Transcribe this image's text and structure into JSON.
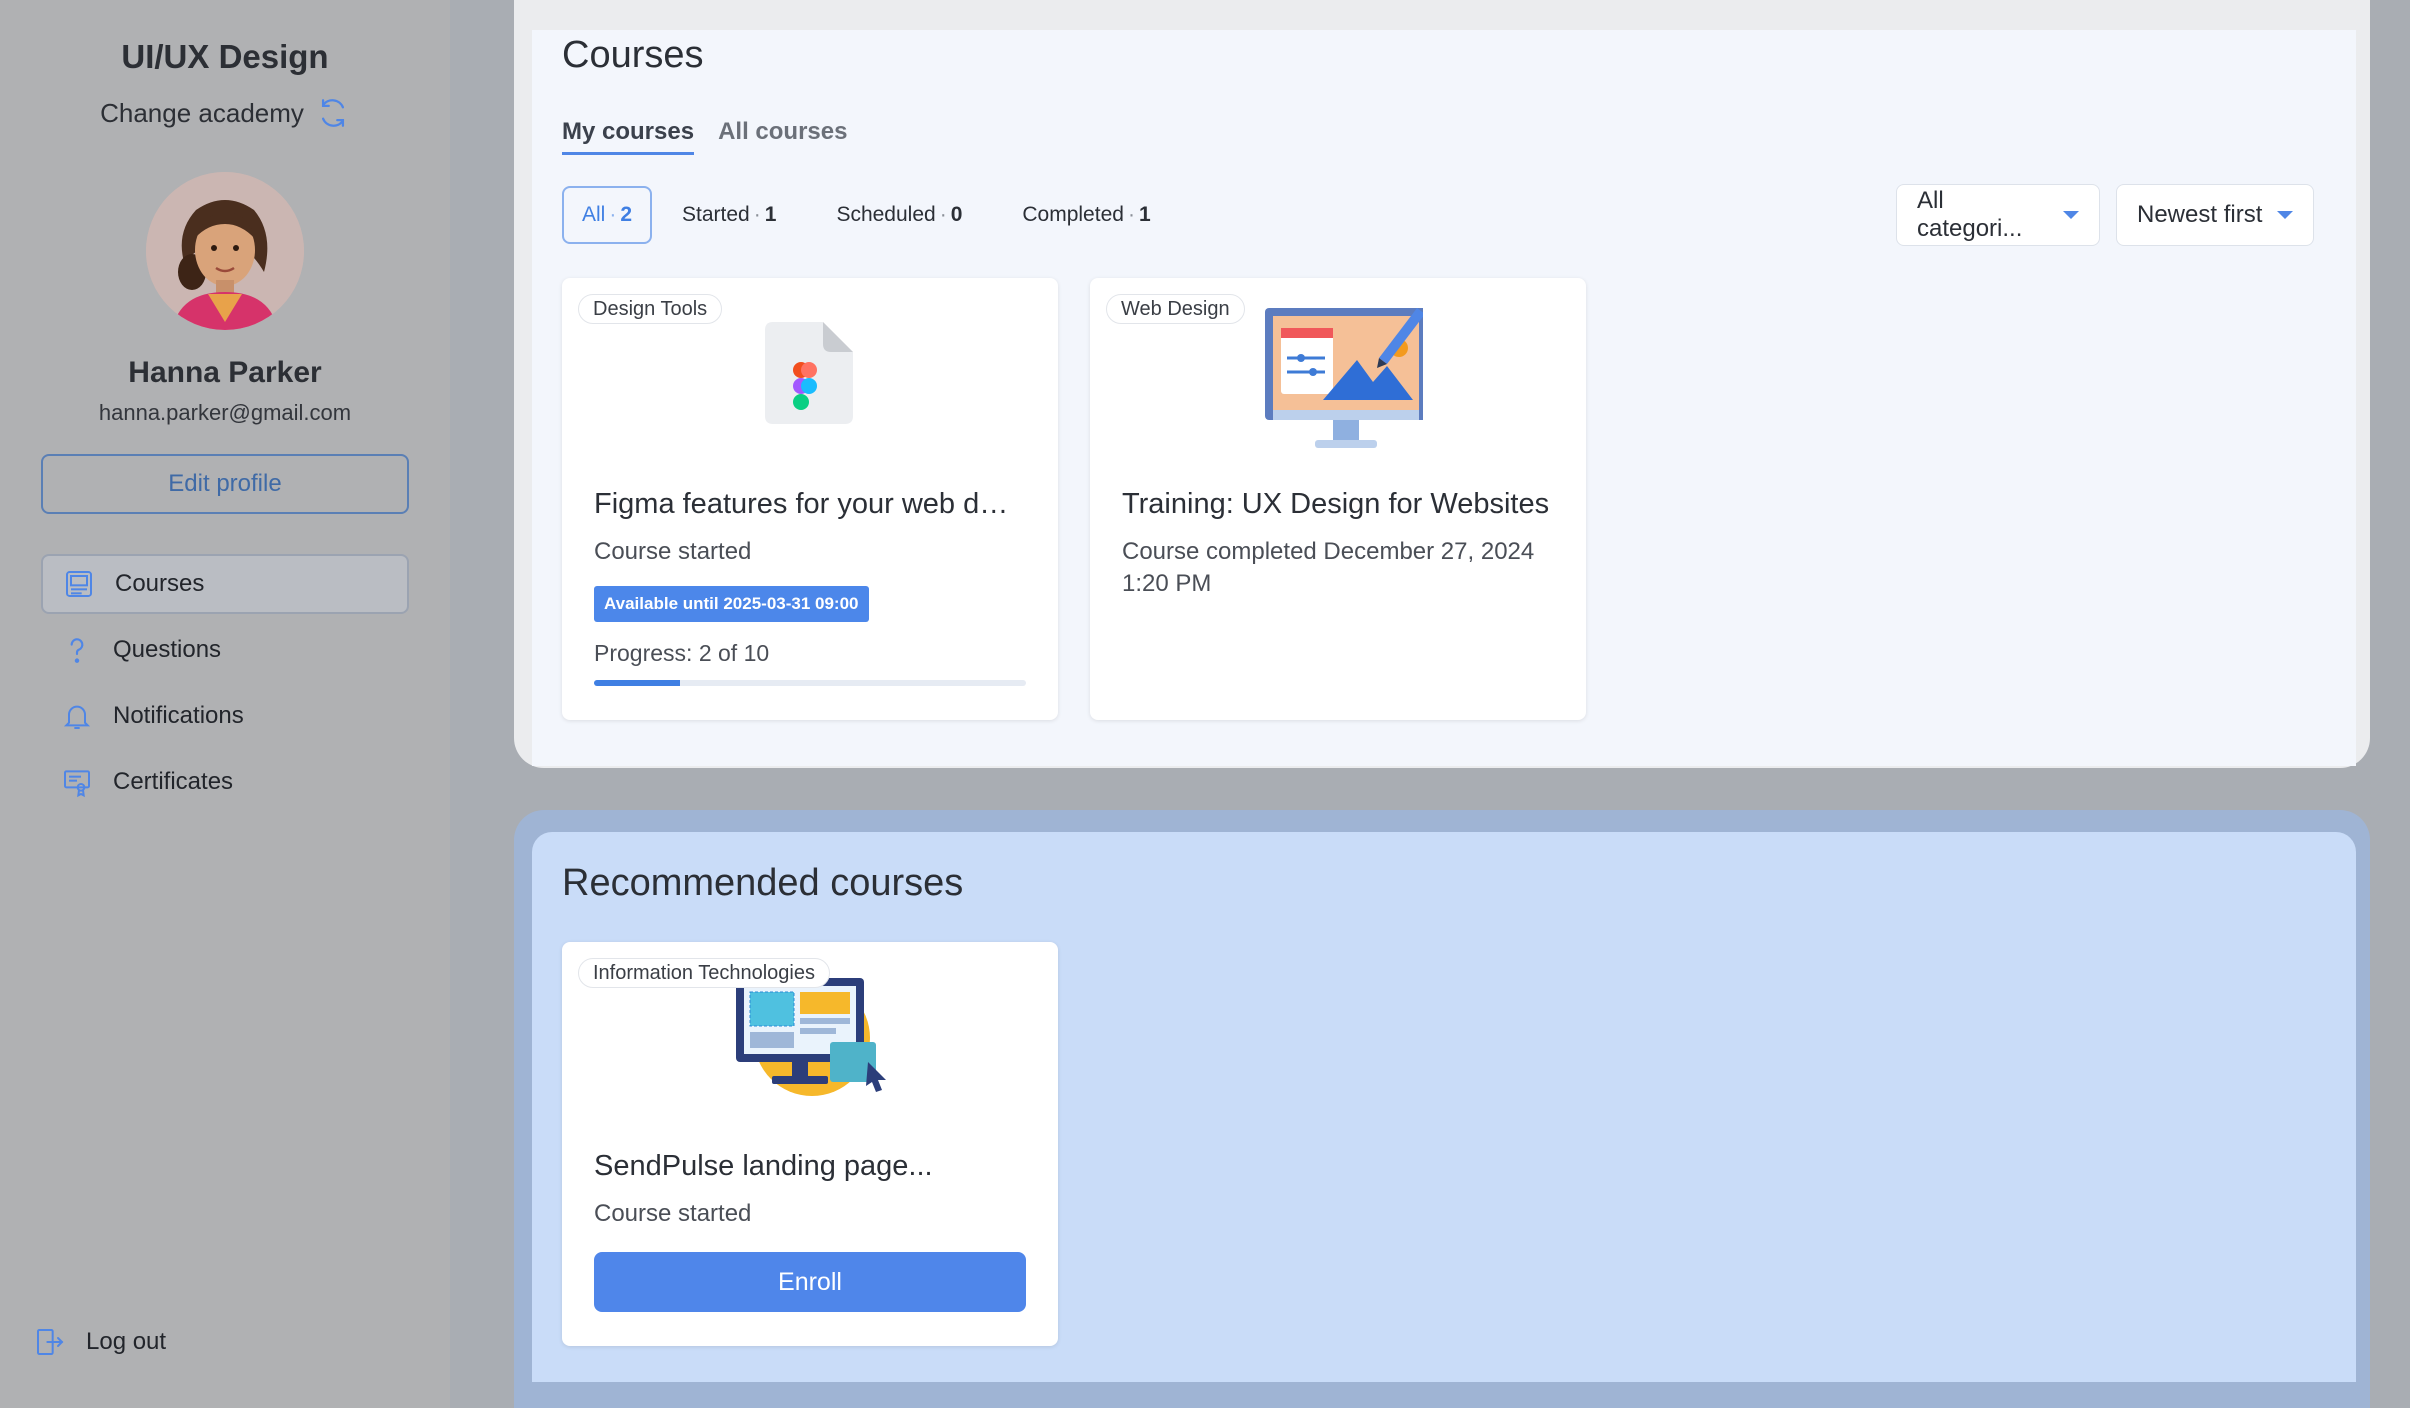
{
  "sidebar": {
    "academy_title": "UI/UX Design",
    "change_academy": "Change academy",
    "user_name": "Hanna Parker",
    "user_email": "hanna.parker@gmail.com",
    "edit_profile": "Edit profile",
    "nav": [
      {
        "label": "Courses",
        "icon": "courses-icon",
        "active": true
      },
      {
        "label": "Questions",
        "icon": "question-icon",
        "active": false
      },
      {
        "label": "Notifications",
        "icon": "bell-icon",
        "active": false
      },
      {
        "label": "Certificates",
        "icon": "certificate-icon",
        "active": false
      }
    ],
    "logout": "Log out"
  },
  "courses": {
    "title": "Courses",
    "tabs": [
      {
        "label": "My courses",
        "active": true
      },
      {
        "label": "All courses",
        "active": false
      }
    ],
    "filters": [
      {
        "label": "All",
        "count": "2",
        "active": true
      },
      {
        "label": "Started",
        "count": "1",
        "active": false
      },
      {
        "label": "Scheduled",
        "count": "0",
        "active": false
      },
      {
        "label": "Completed",
        "count": "1",
        "active": false
      }
    ],
    "category_select": "All categori...",
    "sort_select": "Newest first",
    "cards": [
      {
        "category": "Design Tools",
        "title": "Figma features for your web design",
        "status": "Course started",
        "available_until": "Available until 2025-03-31 09:00",
        "progress_label": "Progress: 2 of 10",
        "progress_fraction": 0.2
      },
      {
        "category": "Web Design",
        "title": "Training: UX Design for Websites",
        "status_line1": "Course completed December 27, 2024",
        "status_line2": "1:20 PM"
      }
    ]
  },
  "recommended": {
    "title": "Recommended courses",
    "cards": [
      {
        "category": "Information Technologies",
        "title": "SendPulse landing page...",
        "status": "Course started",
        "enroll": "Enroll"
      }
    ]
  },
  "colors": {
    "accent": "#4f86ea",
    "sidebar_bg": "#b0b1b3",
    "recommended_bg": "#c9dcf8"
  }
}
